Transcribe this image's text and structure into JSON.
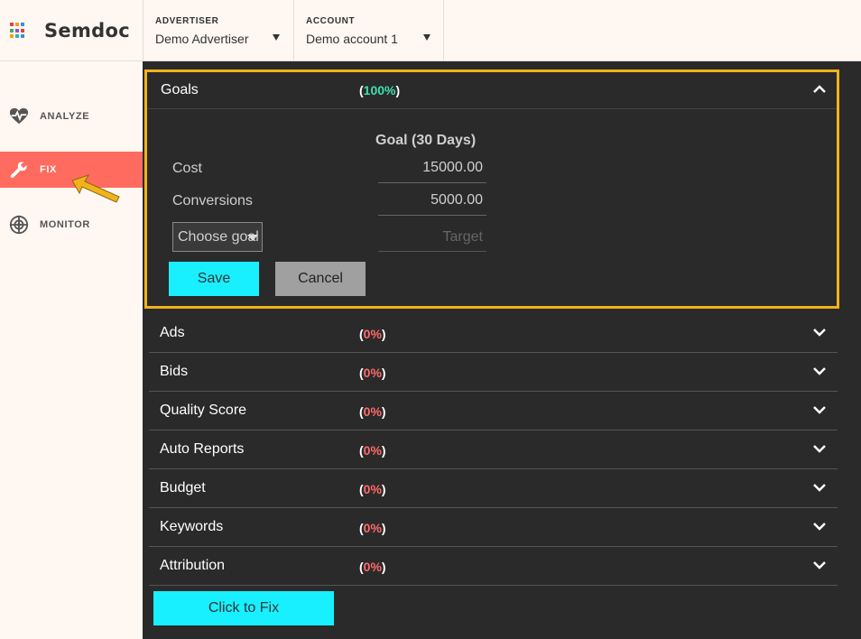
{
  "header": {
    "app_name": "Semdoc",
    "advertiser": {
      "caption": "ADVERTISER",
      "value": "Demo Advertiser"
    },
    "account": {
      "caption": "ACCOUNT",
      "value": "Demo account 1"
    }
  },
  "sidebar": {
    "items": [
      {
        "label": "ANALYZE",
        "icon": "heart-pulse-icon"
      },
      {
        "label": "FIX",
        "icon": "wrench-icon",
        "active": true
      },
      {
        "label": "MONITOR",
        "icon": "radar-icon"
      }
    ]
  },
  "goals": {
    "title": "Goals",
    "pct_open": "(",
    "pct_value": "100%",
    "pct_close": ")",
    "column_title": "Goal (30 Days)",
    "rows": [
      {
        "label": "Cost",
        "value": "15000.00"
      },
      {
        "label": "Conversions",
        "value": "5000.00"
      }
    ],
    "choose_placeholder": "Choose goal",
    "target_placeholder": "Target",
    "save_label": "Save",
    "cancel_label": "Cancel"
  },
  "sections": [
    {
      "title": "Ads",
      "pct": "0%"
    },
    {
      "title": "Bids",
      "pct": "0%"
    },
    {
      "title": "Quality Score",
      "pct": "0%"
    },
    {
      "title": "Auto Reports",
      "pct": "0%"
    },
    {
      "title": "Budget",
      "pct": "0%"
    },
    {
      "title": "Keywords",
      "pct": "0%"
    },
    {
      "title": "Attribution",
      "pct": "0%"
    }
  ],
  "paren_open": "(",
  "paren_close": ")",
  "fix_button_label": "Click to Fix",
  "colors": {
    "accent_active": "#ff6b5e",
    "button_primary": "#18f0ff",
    "highlight_border": "#f2b21b",
    "pct_good": "#3ee0b0",
    "pct_bad": "#ff6b6b"
  }
}
